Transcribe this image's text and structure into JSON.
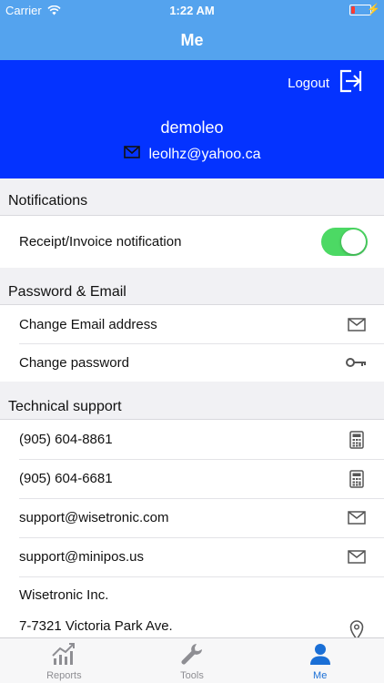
{
  "status_bar": {
    "carrier": "Carrier",
    "time": "1:22 AM"
  },
  "nav": {
    "title": "Me"
  },
  "profile": {
    "logout_label": "Logout",
    "username": "demoleo",
    "email": "leolhz@yahoo.ca"
  },
  "sections": {
    "notifications": {
      "header": "Notifications",
      "receipt_label": "Receipt/Invoice notification",
      "receipt_enabled": true
    },
    "password_email": {
      "header": "Password & Email",
      "change_email": "Change Email address",
      "change_password": "Change password"
    },
    "support": {
      "header": "Technical support",
      "phone1": "(905) 604-8861",
      "phone2": "(905) 604-6681",
      "email1": "support@wisetronic.com",
      "email2": "support@minipos.us",
      "company": "Wisetronic Inc.",
      "address": "7-7321 Victoria Park Ave."
    }
  },
  "tabs": [
    {
      "label": "Reports",
      "icon": "chart-icon"
    },
    {
      "label": "Tools",
      "icon": "wrench-icon"
    },
    {
      "label": "Me",
      "icon": "person-icon"
    }
  ],
  "colors": {
    "header_blue": "#54a3ee",
    "profile_blue": "#0433ff",
    "toggle_green": "#4cd964",
    "tab_active": "#1a6fd6"
  }
}
